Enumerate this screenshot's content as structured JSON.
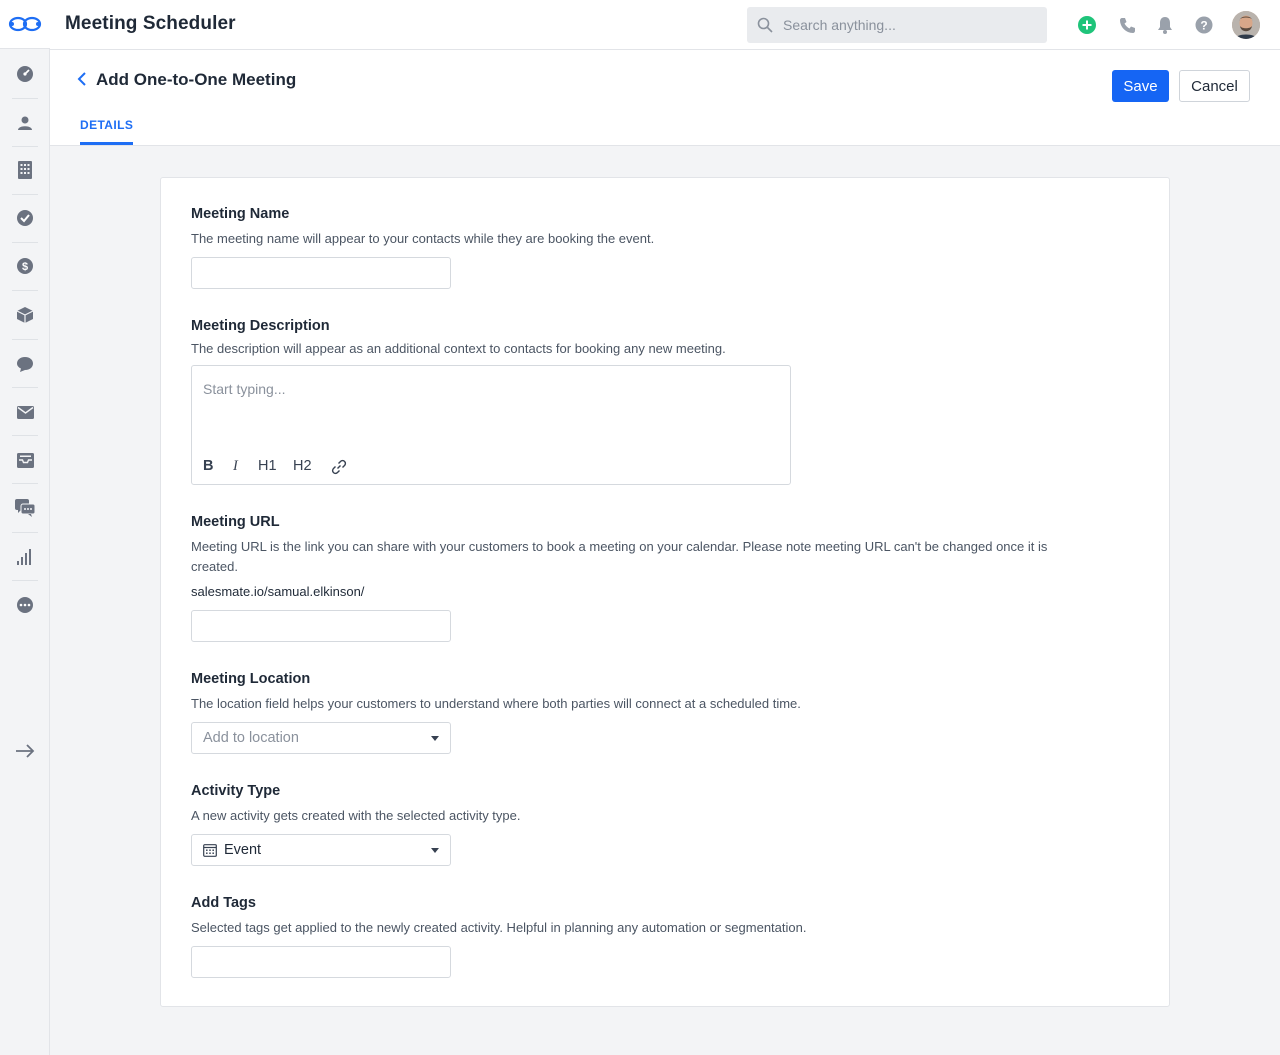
{
  "app": {
    "title": "Meeting Scheduler"
  },
  "search": {
    "placeholder": "Search anything..."
  },
  "sidebar": {
    "items": [
      {
        "name": "dashboard-icon"
      },
      {
        "name": "contacts-icon"
      },
      {
        "name": "companies-icon"
      },
      {
        "name": "tasks-icon"
      },
      {
        "name": "deals-icon"
      },
      {
        "name": "products-icon"
      },
      {
        "name": "chat-icon"
      },
      {
        "name": "email-icon"
      },
      {
        "name": "inbox-icon"
      },
      {
        "name": "messages-icon"
      },
      {
        "name": "reports-icon"
      },
      {
        "name": "more-icon"
      },
      {
        "name": "expand-arrow-icon"
      }
    ]
  },
  "header_icons": [
    "add-icon",
    "phone-icon",
    "bell-icon",
    "help-icon"
  ],
  "colors": {
    "primary": "#1565f4",
    "add_green": "#1fc47a"
  },
  "page": {
    "title": "Add One-to-One Meeting",
    "save_label": "Save",
    "cancel_label": "Cancel",
    "tabs": [
      {
        "label": "DETAILS",
        "active": true
      }
    ]
  },
  "form": {
    "name": {
      "label": "Meeting Name",
      "help": "The meeting name will appear to your contacts while they are booking the event.",
      "value": ""
    },
    "description": {
      "label": "Meeting Description",
      "help": "The description will appear as an additional context to contacts for booking any new meeting.",
      "placeholder": "Start typing...",
      "toolbar": {
        "bold": "B",
        "italic": "I",
        "h1": "H1",
        "h2": "H2"
      }
    },
    "url": {
      "label": "Meeting URL",
      "help_line1": "Meeting URL is the link you can share with your customers to book a meeting on your calendar. Please note meeting URL can't be changed once it is",
      "help_line2": "created.",
      "prefix": "salesmate.io/samual.elkinson/",
      "value": ""
    },
    "location": {
      "label": "Meeting Location",
      "help": "The location field helps your customers to understand where both parties will connect at a scheduled time.",
      "placeholder": "Add to location"
    },
    "activity_type": {
      "label": "Activity Type",
      "help": "A new activity gets created with the selected activity type.",
      "value": "Event"
    },
    "tags": {
      "label": "Add Tags",
      "help": "Selected tags get applied to the newly created activity. Helpful in planning any automation or segmentation.",
      "value": ""
    }
  }
}
